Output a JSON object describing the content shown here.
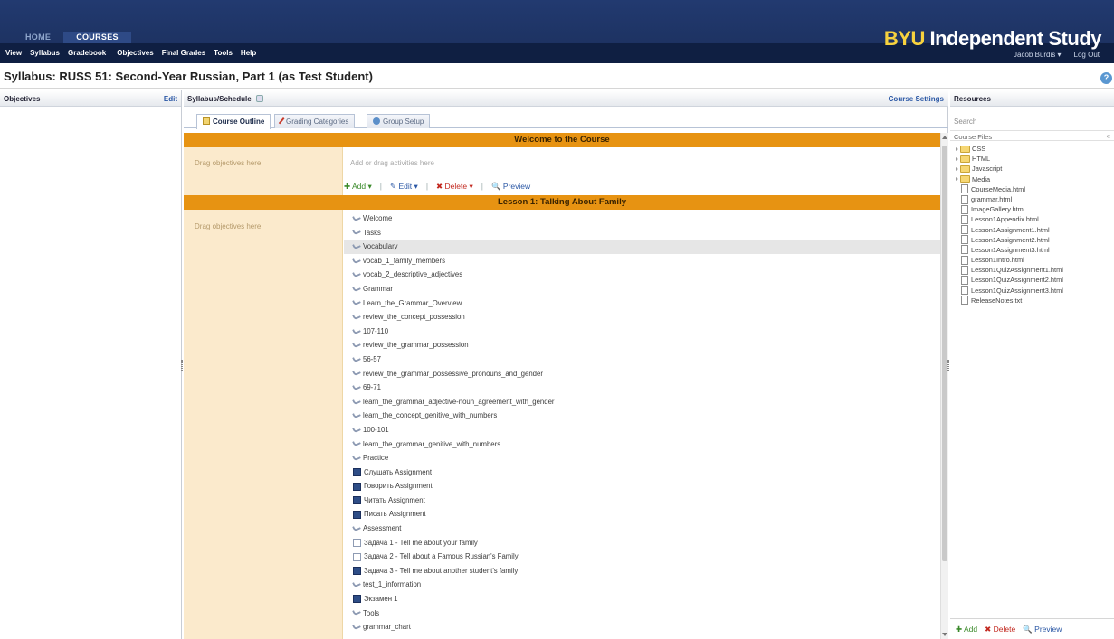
{
  "topnav": {
    "tabs": [
      {
        "label": "HOME"
      },
      {
        "label": "COURSES"
      }
    ],
    "menu": [
      "View",
      "Syllabus",
      "Gradebook",
      "Objectives",
      "Final Grades",
      "Tools",
      "Help"
    ],
    "brand_prefix": "BYU",
    "brand_suffix": " Independent Study",
    "user_name": "Jacob Burdis",
    "user_caret": "▾",
    "logout_label": "Log Out"
  },
  "page": {
    "title": "Syllabus: RUSS 51: Second-Year Russian, Part 1 (as Test Student)",
    "help_icon": "?"
  },
  "objectives": {
    "title": "Objectives",
    "edit_label": "Edit"
  },
  "syllabus": {
    "title": "Syllabus/Schedule",
    "course_settings_label": "Course Settings",
    "tabs": [
      {
        "label": "Course Outline",
        "icon": "outline-icon"
      },
      {
        "label": "Grading Categories",
        "icon": "pencil-icon"
      },
      {
        "label": "Group Setup",
        "icon": "group-icon"
      }
    ],
    "sections": [
      {
        "title": "Welcome to the Course",
        "drag_hint": "Drag objectives here",
        "activity_hint": "Add or drag activities here",
        "actions": {
          "add": "Add",
          "edit": "Edit",
          "delete": "Delete",
          "preview": "Preview",
          "caret": "▾",
          "separator": "|"
        }
      },
      {
        "title": "Lesson 1: Talking About Family",
        "drag_hint": "Drag objectives here",
        "activities": [
          {
            "label": "Welcome",
            "icon": "link-icon"
          },
          {
            "label": "Tasks",
            "icon": "link-icon"
          },
          {
            "label": "Vocabulary",
            "icon": "link-icon",
            "highlighted": true
          },
          {
            "label": "vocab_1_family_members",
            "icon": "link-icon"
          },
          {
            "label": "vocab_2_descriptive_adjectives",
            "icon": "link-icon"
          },
          {
            "label": "Grammar",
            "icon": "link-icon"
          },
          {
            "label": "Learn_the_Grammar_Overview",
            "icon": "link-icon"
          },
          {
            "label": "review_the_concept_possession",
            "icon": "link-icon"
          },
          {
            "label": "107-110",
            "icon": "link-icon"
          },
          {
            "label": "review_the_grammar_possession",
            "icon": "link-icon"
          },
          {
            "label": "56-57",
            "icon": "link-icon"
          },
          {
            "label": "review_the_grammar_possessive_pronouns_and_gender",
            "icon": "link-icon"
          },
          {
            "label": "69-71",
            "icon": "link-icon"
          },
          {
            "label": "learn_the_grammar_adjective-noun_agreement_with_gender",
            "icon": "link-icon"
          },
          {
            "label": "learn_the_concept_genitive_with_numbers",
            "icon": "link-icon"
          },
          {
            "label": "100-101",
            "icon": "link-icon"
          },
          {
            "label": "learn_the_grammar_genitive_with_numbers",
            "icon": "link-icon"
          },
          {
            "label": "Practice",
            "icon": "link-icon"
          },
          {
            "label": "Слушать Assignment",
            "icon": "assignment-icon"
          },
          {
            "label": "Говорить Assignment",
            "icon": "assignment-icon"
          },
          {
            "label": "Читать Assignment",
            "icon": "assignment-icon"
          },
          {
            "label": "Писать Assignment",
            "icon": "assignment-icon"
          },
          {
            "label": "Assessment",
            "icon": "link-icon"
          },
          {
            "label": "Задача 1 - Tell me about your family",
            "icon": "document-icon"
          },
          {
            "label": "Задача 2 - Tell about a Famous Russian's Family",
            "icon": "document-icon"
          },
          {
            "label": "Задача 3 - Tell me about another student's family",
            "icon": "assignment-icon"
          },
          {
            "label": "test_1_information",
            "icon": "link-icon"
          },
          {
            "label": "Экзамен 1",
            "icon": "assignment-icon"
          },
          {
            "label": "Tools",
            "icon": "link-icon"
          },
          {
            "label": "grammar_chart",
            "icon": "link-icon"
          }
        ]
      }
    ]
  },
  "resources": {
    "title": "Resources",
    "search_placeholder": "Search",
    "files_label": "Course Files",
    "collapse_icon": "«",
    "tree": [
      {
        "label": "CSS",
        "type": "folder"
      },
      {
        "label": "HTML",
        "type": "folder"
      },
      {
        "label": "Javascript",
        "type": "folder"
      },
      {
        "label": "Media",
        "type": "folder"
      },
      {
        "label": "CourseMedia.html",
        "type": "file"
      },
      {
        "label": "grammar.html",
        "type": "file"
      },
      {
        "label": "ImageGallery.html",
        "type": "file"
      },
      {
        "label": "Lesson1Appendix.html",
        "type": "file"
      },
      {
        "label": "Lesson1Assignment1.html",
        "type": "file"
      },
      {
        "label": "Lesson1Assignment2.html",
        "type": "file"
      },
      {
        "label": "Lesson1Assignment3.html",
        "type": "file"
      },
      {
        "label": "Lesson1Intro.html",
        "type": "file"
      },
      {
        "label": "Lesson1QuizAssignment1.html",
        "type": "file"
      },
      {
        "label": "Lesson1QuizAssignment2.html",
        "type": "file"
      },
      {
        "label": "Lesson1QuizAssignment3.html",
        "type": "file"
      },
      {
        "label": "ReleaseNotes.txt",
        "type": "file"
      }
    ],
    "actions": {
      "add": "Add",
      "delete": "Delete",
      "preview": "Preview"
    }
  },
  "colors": {
    "banner": "#1b2f5c",
    "lesson_bar": "#e79312",
    "drag_column": "#fbeacc",
    "link": "#2a57a5"
  }
}
